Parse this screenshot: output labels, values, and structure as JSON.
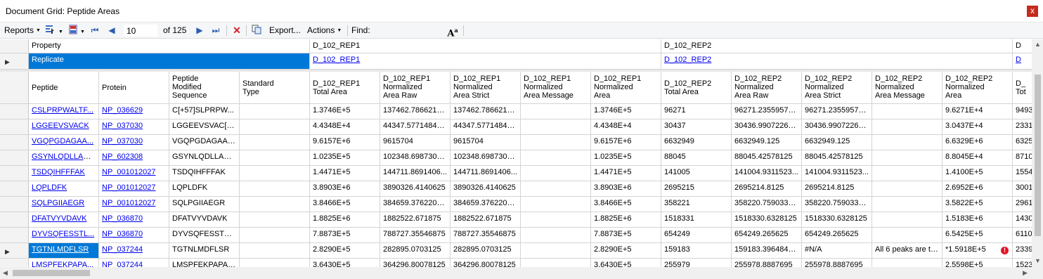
{
  "window": {
    "title": "Document Grid: Peptide Areas",
    "close_glyph": "x"
  },
  "toolbar": {
    "reports_label": "Reports",
    "position_value": "10",
    "of_label": "of 125",
    "export_label": "Export...",
    "actions_label": "Actions",
    "find_label": "Find:",
    "find_value": "",
    "icons": [
      "choose-columns-icon",
      "doc-filter-icon",
      "first-page-icon",
      "previous-page-icon",
      "next-page-icon",
      "last-page-icon",
      "delete-icon",
      "copy-icon",
      "font-size-icon"
    ]
  },
  "grid": {
    "property_label": "Property",
    "replicate_label": "Replicate",
    "groups": [
      {
        "name": "D_102_REP1",
        "link": "D_102_REP1"
      },
      {
        "name": "D_102_REP2",
        "link": "D_102_REP2"
      },
      {
        "name": "D",
        "link": "D"
      }
    ],
    "columns": [
      {
        "label": "Peptide"
      },
      {
        "label": "Protein"
      },
      {
        "label": "Peptide\nModified\nSequence"
      },
      {
        "label": "Standard\nType"
      },
      {
        "label": "D_102_REP1\nTotal Area"
      },
      {
        "label": "D_102_REP1\nNormalized\nArea Raw"
      },
      {
        "label": "D_102_REP1\nNormalized\nArea Strict"
      },
      {
        "label": "D_102_REP1\nNormalized\nArea Message"
      },
      {
        "label": "D_102_REP1\nNormalized\nArea"
      },
      {
        "label": "D_102_REP2\nTotal Area"
      },
      {
        "label": "D_102_REP2\nNormalized\nArea Raw"
      },
      {
        "label": "D_102_REP2\nNormalized\nArea Strict"
      },
      {
        "label": "D_102_REP2\nNormalized\nArea Message"
      },
      {
        "label": "D_102_REP2\nNormalized\nArea"
      },
      {
        "label": "D_\nTot"
      }
    ],
    "rows": [
      {
        "peptide": "CSLPRPWALTF...",
        "protein": "NP_036629",
        "modseq": "C[+57]SLPRPW...",
        "std": "",
        "r1_total": "1.3746E+5",
        "r1_raw": "137462.7866210...",
        "r1_strict": "137462.7866210...",
        "r1_msg": "",
        "r1_area": "1.3746E+5",
        "r2_total": "96271",
        "r2_raw": "96271.23559570...",
        "r2_strict": "96271.23559570...",
        "r2_msg": "",
        "r2_area": "9.6271E+4",
        "d_tot": "9493"
      },
      {
        "peptide": "LGGEEVSVACK",
        "protein": "NP_037030",
        "modseq": "LGGEEVSVAC[+...",
        "std": "",
        "r1_total": "4.4348E+4",
        "r1_raw": "44347.57714843...",
        "r1_strict": "44347.57714843...",
        "r1_msg": "",
        "r1_area": "4.4348E+4",
        "r2_total": "30437",
        "r2_raw": "30436.99072265...",
        "r2_strict": "30436.99072265...",
        "r2_msg": "",
        "r2_area": "3.0437E+4",
        "d_tot": "2331"
      },
      {
        "peptide": "VGQPGDAGAA...",
        "protein": "NP_037030",
        "modseq": "VGQPGDAGAAG...",
        "std": "",
        "r1_total": "9.6157E+6",
        "r1_raw": "9615704",
        "r1_strict": "9615704",
        "r1_msg": "",
        "r1_area": "9.6157E+6",
        "r2_total": "6632949",
        "r2_raw": "6632949.125",
        "r2_strict": "6632949.125",
        "r2_msg": "",
        "r2_area": "6.6329E+6",
        "d_tot": "6325"
      },
      {
        "peptide": "GSYNLQDLLAQ...",
        "protein": "NP_602308",
        "modseq": "GSYNLQDLLAQ...",
        "std": "",
        "r1_total": "1.0235E+5",
        "r1_raw": "102348.6987304...",
        "r1_strict": "102348.6987304...",
        "r1_msg": "",
        "r1_area": "1.0235E+5",
        "r2_total": "88045",
        "r2_raw": "88045.42578125",
        "r2_strict": "88045.42578125",
        "r2_msg": "",
        "r2_area": "8.8045E+4",
        "d_tot": "8710"
      },
      {
        "peptide": "TSDQIHFFFAK",
        "protein": "NP_001012027",
        "modseq": "TSDQIHFFFAK",
        "std": "",
        "r1_total": "1.4471E+5",
        "r1_raw": "144711.8691406...",
        "r1_strict": "144711.8691406...",
        "r1_msg": "",
        "r1_area": "1.4471E+5",
        "r2_total": "141005",
        "r2_raw": "141004.9311523...",
        "r2_strict": "141004.9311523...",
        "r2_msg": "",
        "r2_area": "1.4100E+5",
        "d_tot": "1554"
      },
      {
        "peptide": "LQPLDFK",
        "protein": "NP_001012027",
        "modseq": "LQPLDFK",
        "std": "",
        "r1_total": "3.8903E+6",
        "r1_raw": "3890326.4140625",
        "r1_strict": "3890326.4140625",
        "r1_msg": "",
        "r1_area": "3.8903E+6",
        "r2_total": "2695215",
        "r2_raw": "2695214.8125",
        "r2_strict": "2695214.8125",
        "r2_msg": "",
        "r2_area": "2.6952E+6",
        "d_tot": "3001"
      },
      {
        "peptide": "SQLPGIIAEGR",
        "protein": "NP_001012027",
        "modseq": "SQLPGIIAEGR",
        "std": "",
        "r1_total": "3.8466E+5",
        "r1_raw": "384659.3762207...",
        "r1_strict": "384659.3762207...",
        "r1_msg": "",
        "r1_area": "3.8466E+5",
        "r2_total": "358221",
        "r2_raw": "358220.7590332...",
        "r2_strict": "358220.7590332...",
        "r2_msg": "",
        "r2_area": "3.5822E+5",
        "d_tot": "2961"
      },
      {
        "peptide": "DFATVYVDAVK",
        "protein": "NP_036870",
        "modseq": "DFATVYVDAVK",
        "std": "",
        "r1_total": "1.8825E+6",
        "r1_raw": "1882522.671875",
        "r1_strict": "1882522.671875",
        "r1_msg": "",
        "r1_area": "1.8825E+6",
        "r2_total": "1518331",
        "r2_raw": "1518330.6328125",
        "r2_strict": "1518330.6328125",
        "r2_msg": "",
        "r2_area": "1.5183E+6",
        "d_tot": "1430"
      },
      {
        "peptide": "DYVSQFESSTL...",
        "protein": "NP_036870",
        "modseq": "DYVSQFESSTLGK",
        "std": "",
        "r1_total": "7.8873E+5",
        "r1_raw": "788727.35546875",
        "r1_strict": "788727.35546875",
        "r1_msg": "",
        "r1_area": "7.8873E+5",
        "r2_total": "654249",
        "r2_raw": "654249.265625",
        "r2_strict": "654249.265625",
        "r2_msg": "",
        "r2_area": "6.5425E+5",
        "d_tot": "6110"
      },
      {
        "peptide": "TGTNLMDFLSR",
        "protein": "NP_037244",
        "modseq": "TGTNLMDFLSR",
        "std": "",
        "r1_total": "2.8290E+5",
        "r1_raw": "282895.0703125",
        "r1_strict": "282895.0703125",
        "r1_msg": "",
        "r1_area": "2.8290E+5",
        "r2_total": "159183",
        "r2_raw": "159183.3964843...",
        "r2_strict": "#N/A",
        "r2_msg": "All 6 peaks are tr...",
        "r2_area": "*1.5918E+5",
        "d_tot": "2339",
        "error": true
      },
      {
        "peptide": "LMSPFEKPAPA...",
        "protein": "NP_037244",
        "modseq": "LMSPFEKPAPAAK",
        "std": "",
        "r1_total": "3.6430E+5",
        "r1_raw": "364296.80078125",
        "r1_strict": "364296.80078125",
        "r1_msg": "",
        "r1_area": "3.6430E+5",
        "r2_total": "255979",
        "r2_raw": "255978.8887695",
        "r2_strict": "255978.8887695",
        "r2_msg": "",
        "r2_area": "2.5598E+5",
        "d_tot": "1523"
      }
    ],
    "current_row": 9
  },
  "colors": {
    "selection": "#0078d7",
    "link": "#0000ee",
    "error": "#e81123",
    "close": "#c42b1c"
  }
}
